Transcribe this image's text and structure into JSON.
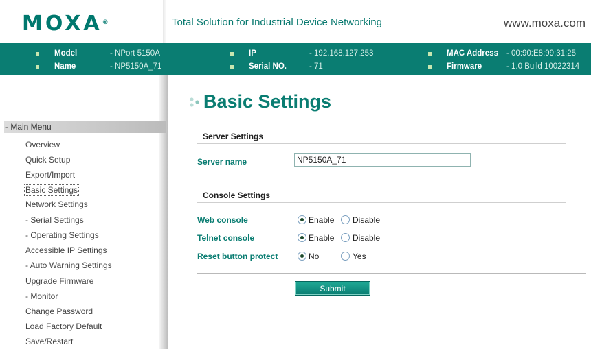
{
  "header": {
    "logo_text": "MOXA",
    "logo_mark": "®",
    "tagline": "Total Solution for Industrial Device Networking",
    "url": "www.moxa.com"
  },
  "device_info": {
    "model": {
      "label": "Model",
      "value": "- NPort 5150A"
    },
    "name": {
      "label": "Name",
      "value": "- NP5150A_71"
    },
    "ip": {
      "label": "IP",
      "value": "- 192.168.127.253"
    },
    "serial": {
      "label": "Serial NO.",
      "value": "- 71"
    },
    "mac": {
      "label": "MAC Address",
      "value": "- 00:90:E8:99:31:25"
    },
    "firmware": {
      "label": "Firmware",
      "value": "- 1.0 Build 10022314"
    }
  },
  "menu": {
    "header": "- Main Menu",
    "items": [
      {
        "label": "Overview"
      },
      {
        "label": "Quick Setup"
      },
      {
        "label": "Export/Import"
      },
      {
        "label": "Basic Settings",
        "active": true
      },
      {
        "label": "Network Settings"
      },
      {
        "label": "- Serial Settings"
      },
      {
        "label": "- Operating Settings"
      },
      {
        "label": "Accessible IP Settings"
      },
      {
        "label": "- Auto Warning Settings"
      },
      {
        "label": "Upgrade Firmware"
      },
      {
        "label": "- Monitor"
      },
      {
        "label": "Change Password"
      },
      {
        "label": "Load Factory Default"
      },
      {
        "label": "Save/Restart"
      }
    ]
  },
  "page": {
    "title": "Basic Settings",
    "server_section": {
      "heading": "Server Settings",
      "server_name_label": "Server name",
      "server_name_value": "NP5150A_71"
    },
    "console_section": {
      "heading": "Console Settings",
      "web_console": {
        "label": "Web console",
        "option_enable": "Enable",
        "option_disable": "Disable",
        "selected": "Enable"
      },
      "telnet_console": {
        "label": "Telnet console",
        "option_enable": "Enable",
        "option_disable": "Disable",
        "selected": "Enable"
      },
      "reset_protect": {
        "label": "Reset button protect",
        "option_no": "No",
        "option_yes": "Yes",
        "selected": "No"
      }
    },
    "submit_label": "Submit"
  },
  "colors": {
    "brand_green": "#0a7d72",
    "infobar_bg": "#0a7d72",
    "label_green": "#0a7d72"
  }
}
